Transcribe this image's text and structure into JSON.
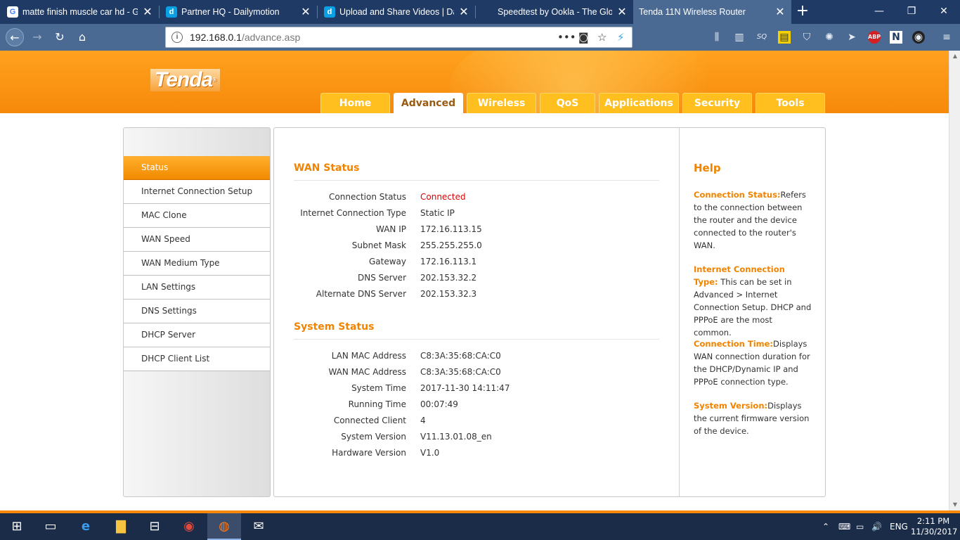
{
  "browser": {
    "tabs": [
      {
        "title": "matte finish muscle car hd - Go",
        "favicon": "G",
        "favicon_color": "#4285f4"
      },
      {
        "title": "Partner HQ - Dailymotion",
        "favicon": "d",
        "favicon_color": "#0aa0e6"
      },
      {
        "title": "Upload and Share Videos | Daily",
        "favicon": "d",
        "favicon_color": "#0aa0e6"
      },
      {
        "title": "Speedtest by Ookla - The Globa",
        "favicon": "",
        "favicon_color": "#1f3a64"
      },
      {
        "title": "Tenda 11N Wireless Router",
        "favicon": "",
        "favicon_color": "#4a6a94"
      }
    ],
    "url_host": "192.168.0.1",
    "url_path": "/advance.asp",
    "toolbar_icons": [
      "library-icon",
      "sidebar-icon",
      "sq-icon",
      "notes-icon",
      "shield-icon",
      "extension-icon",
      "arrow-icon",
      "abp-icon",
      "n-icon",
      "camera-icon",
      "menu-icon"
    ]
  },
  "router": {
    "logo": "Tenda",
    "logo_mark": "®",
    "nav_tabs": [
      "Home",
      "Advanced",
      "Wireless",
      "QoS",
      "Applications",
      "Security",
      "Tools"
    ],
    "active_tab": "Advanced",
    "sidebar": [
      "Status",
      "Internet Connection Setup",
      "MAC Clone",
      "WAN Speed",
      "WAN Medium Type",
      "LAN Settings",
      "DNS Settings",
      "DHCP Server",
      "DHCP Client List"
    ],
    "active_sidebar": "Status",
    "wan": {
      "title": "WAN Status",
      "rows": [
        {
          "label": "Connection Status",
          "value": "Connected"
        },
        {
          "label": "Internet Connection Type",
          "value": "Static IP"
        },
        {
          "label": "WAN IP",
          "value": "172.16.113.15"
        },
        {
          "label": "Subnet Mask",
          "value": "255.255.255.0"
        },
        {
          "label": "Gateway",
          "value": "172.16.113.1"
        },
        {
          "label": "DNS Server",
          "value": "202.153.32.2"
        },
        {
          "label": "Alternate DNS Server",
          "value": "202.153.32.3"
        }
      ]
    },
    "system": {
      "title": "System Status",
      "rows": [
        {
          "label": "LAN MAC Address",
          "value": "C8:3A:35:68:CA:C0"
        },
        {
          "label": "WAN MAC Address",
          "value": "C8:3A:35:68:CA:C0"
        },
        {
          "label": "System Time",
          "value": "2017-11-30 14:11:47"
        },
        {
          "label": "Running Time",
          "value": "00:07:49"
        },
        {
          "label": "Connected Client",
          "value": "4"
        },
        {
          "label": "System Version",
          "value": "V11.13.01.08_en"
        },
        {
          "label": "Hardware Version",
          "value": "V1.0"
        }
      ]
    },
    "help": {
      "title": "Help",
      "items": [
        {
          "key": "Connection Status:",
          "text": "Refers to the connection between the router and the device connected to the router's WAN."
        },
        {
          "key": "Internet Connection Type:",
          "text": "This can be set in Advanced > Internet Connection Setup. DHCP and PPPoE are the most common."
        },
        {
          "key": "Connection Time:",
          "text": "Displays WAN connection duration for the DHCP/Dynamic IP and PPPoE connection type."
        },
        {
          "key": "System Version:",
          "text": "Displays the current firmware version of the device."
        }
      ]
    },
    "colors": {
      "accent": "#f08300",
      "connected": "#e00000",
      "header": "#f7890a"
    }
  },
  "taskbar": {
    "apps": [
      "start-icon",
      "task-view-icon",
      "edge-icon",
      "file-explorer-icon",
      "store-icon",
      "chrome-icon",
      "firefox-icon",
      "mail-icon"
    ],
    "language": "ENG",
    "time": "2:11 PM",
    "date": "11/30/2017"
  }
}
